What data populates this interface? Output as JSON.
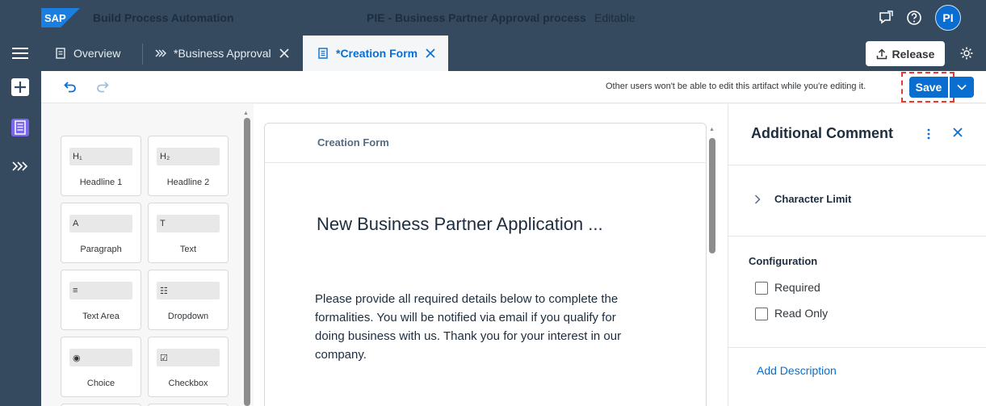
{
  "shell": {
    "logo": "SAP",
    "product": "Build Process Automation",
    "document_title": "PIE - Business Partner Approval process",
    "document_state": "Editable",
    "icons": [
      "feedback-icon",
      "help-icon"
    ],
    "avatar_initials": "PI"
  },
  "tabs": [
    {
      "label": "Overview",
      "icon": "document-icon",
      "closable": false,
      "active": false
    },
    {
      "label": "*Business Approval",
      "icon": "process-chevron-icon",
      "closable": true,
      "active": false
    },
    {
      "label": "*Creation Form",
      "icon": "form-icon",
      "closable": true,
      "active": true
    }
  ],
  "header_actions": {
    "release_label": "Release"
  },
  "toolbar": {
    "edit_note": "Other users won't be able to edit this artifact while you're editing it.",
    "save_label": "Save"
  },
  "palette": {
    "items": [
      {
        "label": "Headline 1",
        "icon_text": "H₁"
      },
      {
        "label": "Headline 2",
        "icon_text": "H₂"
      },
      {
        "label": "Paragraph",
        "icon_text": "A"
      },
      {
        "label": "Text",
        "icon_text": "T"
      },
      {
        "label": "Text Area",
        "icon_text": "≡"
      },
      {
        "label": "Dropdown",
        "icon_text": "☷"
      },
      {
        "label": "Choice",
        "icon_text": "◉"
      },
      {
        "label": "Checkbox",
        "icon_text": "☑"
      }
    ]
  },
  "canvas": {
    "card_title": "Creation Form",
    "headline": "New Business Partner Application ...",
    "paragraph": "Please provide all required details below to complete the formalities. You will be notified via email if you qualify for doing business with us. Thank you for your interest in our company."
  },
  "properties_panel": {
    "title": "Additional Comment",
    "section": "Character Limit",
    "configuration_label": "Configuration",
    "checkboxes": [
      {
        "label": "Required",
        "checked": false
      },
      {
        "label": "Read Only",
        "checked": false
      }
    ],
    "add_description": "Add Description"
  },
  "colors": {
    "shell": "#354a5f",
    "accent": "#0a6ed1",
    "highlight": "#e03c31"
  }
}
